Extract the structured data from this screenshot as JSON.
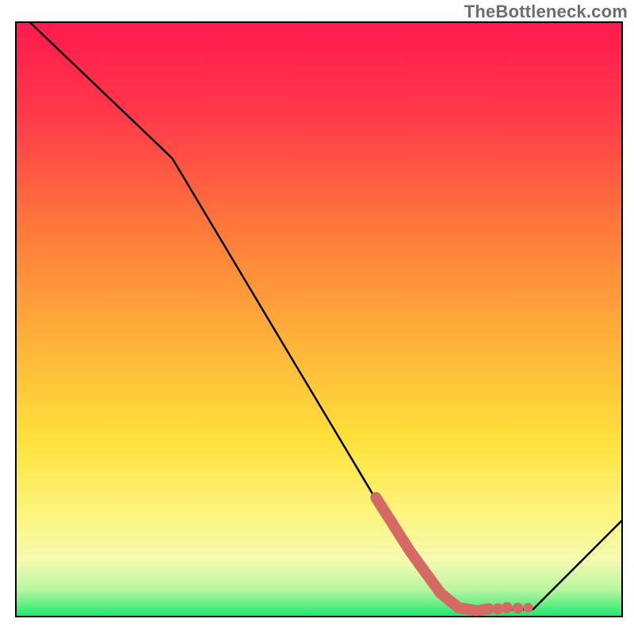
{
  "watermark": "TheBottleneck.com",
  "chart_data": {
    "type": "line",
    "title": "",
    "xlabel": "",
    "ylabel": "",
    "xlim": [
      0,
      100
    ],
    "ylim": [
      0,
      100
    ],
    "grid": false,
    "legend": false,
    "annotations": [],
    "background_gradient": {
      "top": "#ff1a4e",
      "mid_top": "#ff7a3a",
      "mid": "#ffd43a",
      "mid_bot": "#f9fca6",
      "bot": "#17e66e"
    },
    "series": [
      {
        "name": "bottleneck-curve",
        "color": "#000000",
        "x": [
          2.3,
          25.8,
          59.4,
          73.0,
          85.3,
          100.0
        ],
        "y": [
          100.0,
          77.1,
          19.7,
          1.2,
          1.2,
          16.2
        ]
      },
      {
        "name": "highlight-band",
        "color": "#d46a63",
        "style": "thick-dotted-end",
        "x": [
          59.4,
          65.0,
          70.0,
          73.0,
          76.0,
          78.0,
          79.5,
          81.0,
          82.8,
          84.5
        ],
        "y": [
          20.0,
          11.0,
          4.0,
          1.5,
          1.0,
          1.3,
          1.3,
          1.5,
          1.4,
          1.5
        ]
      }
    ]
  }
}
